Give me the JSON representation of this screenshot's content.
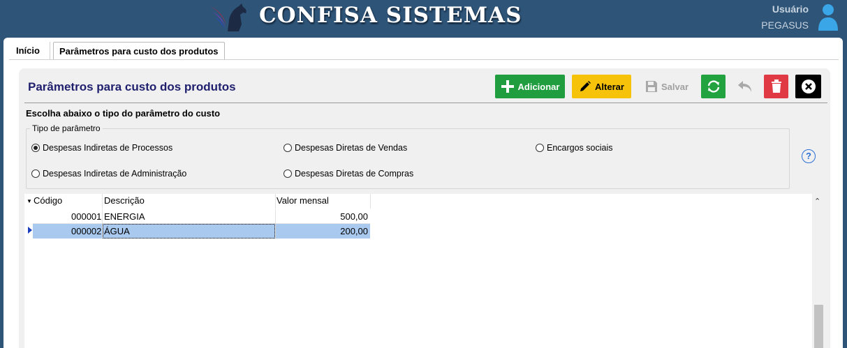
{
  "header": {
    "brand": "CONFISA SISTEMAS",
    "user_label": "Usuário",
    "user_name": "PEGASUS",
    "logo_icon": "pegasus-horse-logo",
    "avatar_icon": "user-icon"
  },
  "tabs": [
    {
      "label": "Início"
    },
    {
      "label": "Parâmetros para custo dos produtos"
    }
  ],
  "page": {
    "title": "Parâmetros para custo dos produtos",
    "instruction": "Escolha abaixo o tipo do parâmetro do custo"
  },
  "toolbar": {
    "add_label": "Adicionar",
    "edit_label": "Alterar",
    "save_label": "Salvar",
    "colors": {
      "add": "#1f9d3f",
      "edit": "#f7c20a",
      "refresh": "#22a340",
      "delete": "#e03a44",
      "close": "#000000"
    }
  },
  "param_type": {
    "legend": "Tipo de parâmetro",
    "options": [
      {
        "label": "Despesas Indiretas de Processos",
        "selected": true
      },
      {
        "label": "Despesas Diretas de Vendas",
        "selected": false
      },
      {
        "label": "Encargos sociais",
        "selected": false
      },
      {
        "label": "Despesas Indiretas de Administração",
        "selected": false
      },
      {
        "label": "Despesas Diretas de Compras",
        "selected": false
      }
    ],
    "help_symbol": "?"
  },
  "grid": {
    "columns": [
      "Código",
      "Descrição",
      "Valor mensal"
    ],
    "rows": [
      {
        "codigo": "000001",
        "descricao": "ENERGIA",
        "valor": "500,00"
      },
      {
        "codigo": "000002",
        "descricao": "ÁGUA",
        "valor": "200,00"
      }
    ],
    "selected_row": 2
  }
}
